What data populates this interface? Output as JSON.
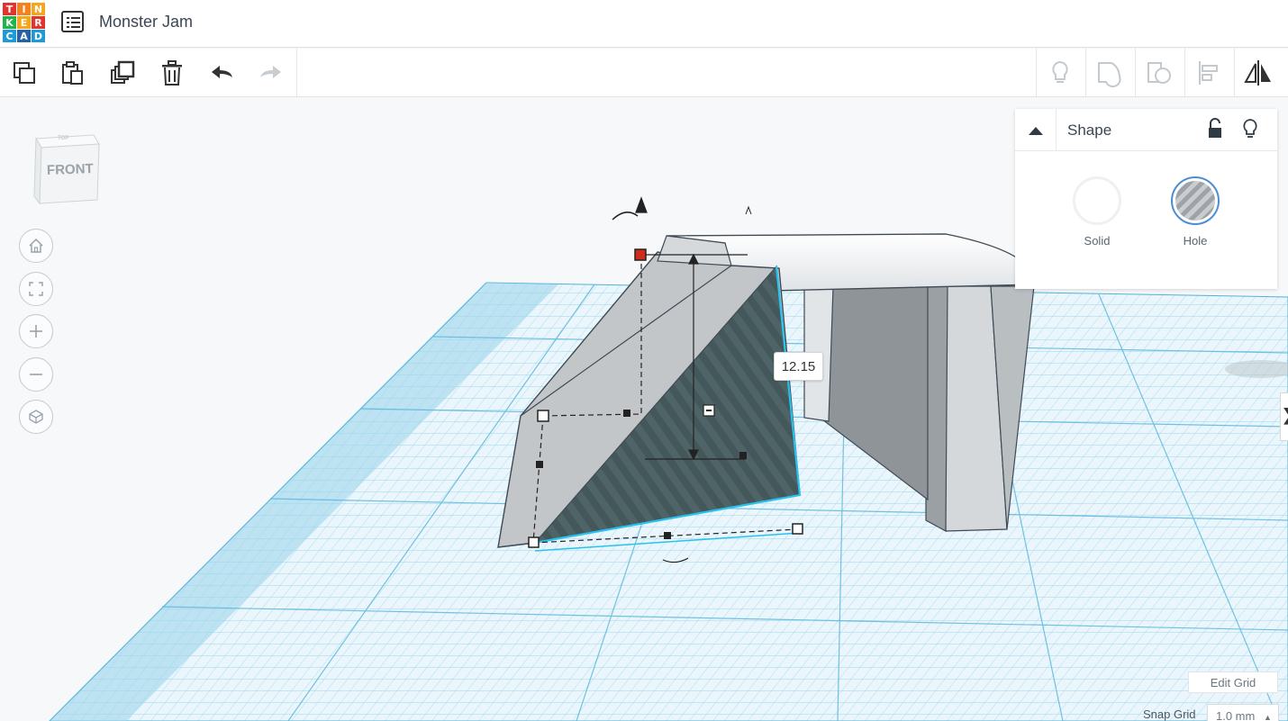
{
  "header": {
    "logo_letters": [
      "T",
      "I",
      "N",
      "K",
      "E",
      "R",
      "C",
      "A",
      "D"
    ],
    "logo_colors": [
      "#e2332f",
      "#f5821f",
      "#f7a51c",
      "#22b34a",
      "#f7a51c",
      "#e2332f",
      "#1e9bd7",
      "#2662a8",
      "#1e9bd7"
    ],
    "title": "Monster Jam"
  },
  "toolbar": {
    "left_tools": [
      "copy-icon",
      "paste-icon",
      "duplicate-icon",
      "delete-icon",
      "undo-icon",
      "redo-icon"
    ],
    "right_tools": [
      "lightbulb-icon",
      "group-icon",
      "ungroup-icon",
      "align-icon",
      "mirror-icon"
    ]
  },
  "viewcube": {
    "face_label": "FRONT"
  },
  "nav_controls": [
    "home-view-icon",
    "fit-view-icon",
    "zoom-in-icon",
    "zoom-out-icon",
    "perspective-icon"
  ],
  "shape_panel": {
    "title": "Shape",
    "options": [
      {
        "label": "Solid",
        "selected": false
      },
      {
        "label": "Hole",
        "selected": true
      }
    ]
  },
  "dimension_readout": "12.15",
  "grid": {
    "edit_label": "Edit Grid",
    "snap_label": "Snap Grid",
    "snap_value": "1.0 mm"
  },
  "colors": {
    "accent": "#1477d1",
    "grid_line": "#6cc3e2",
    "hole_fill": "#3e5658"
  }
}
